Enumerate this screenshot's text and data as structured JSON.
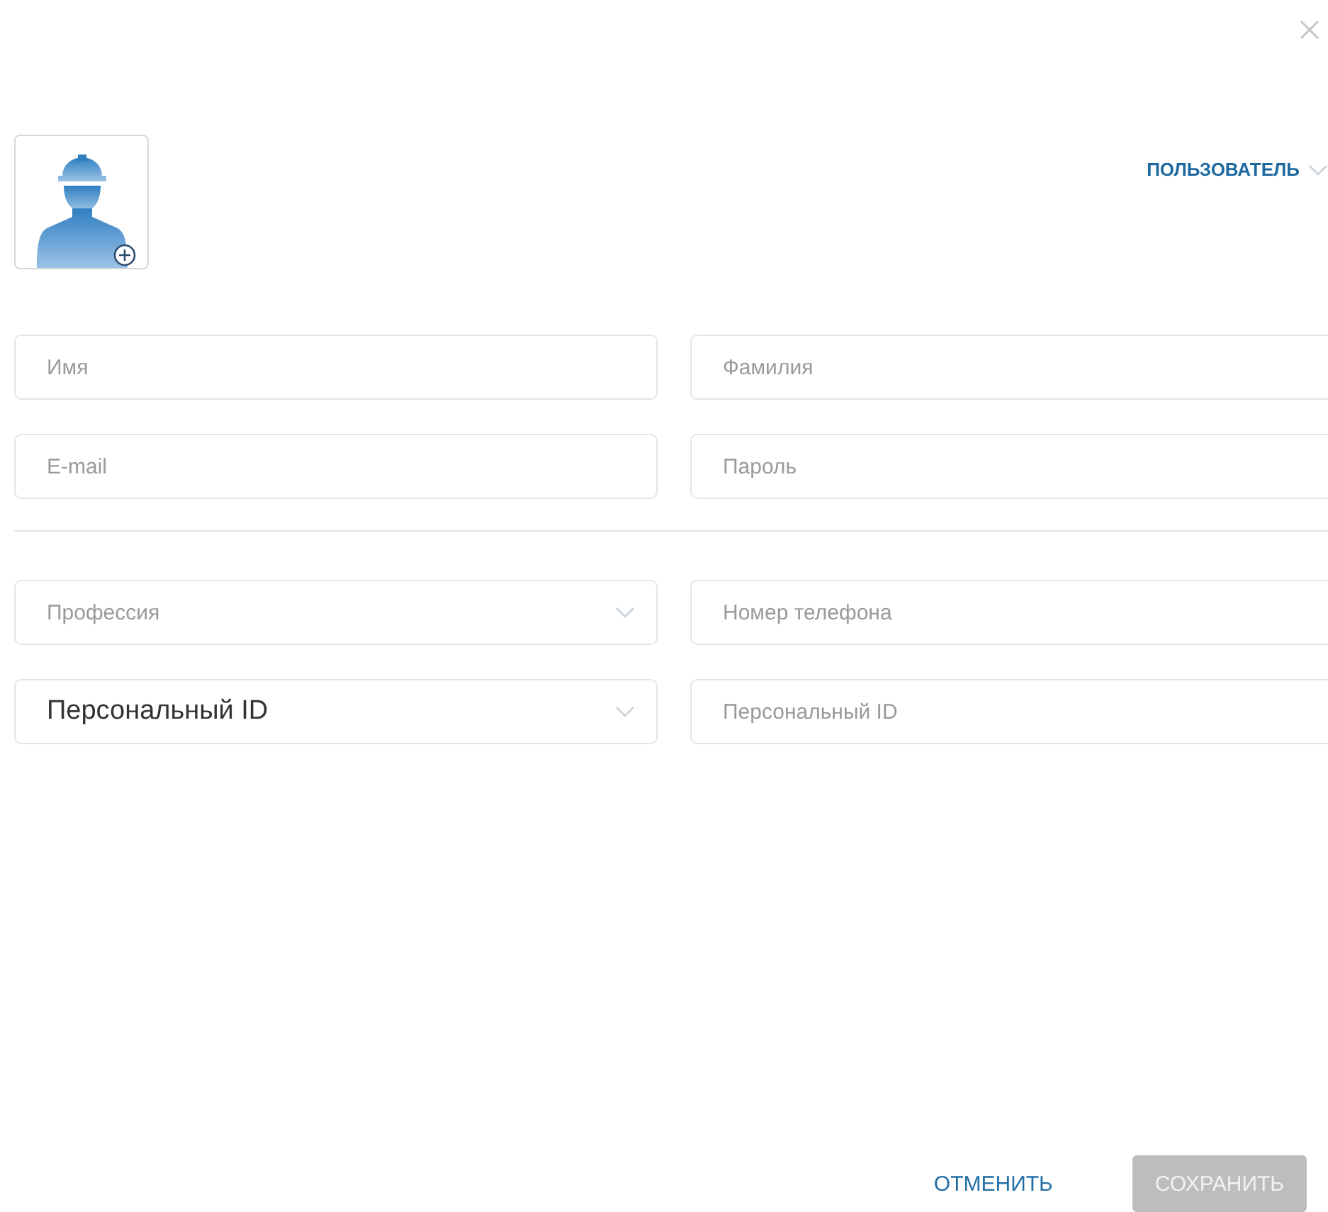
{
  "role_select": {
    "value": "ПОЛЬЗОВАТЕЛЬ"
  },
  "field_groups": [
    {
      "rows": [
        [
          {
            "kind": "input",
            "placeholder": "Имя"
          },
          {
            "kind": "input",
            "placeholder": "Фамилия"
          }
        ],
        [
          {
            "kind": "input",
            "placeholder": "E-mail"
          },
          {
            "kind": "input",
            "placeholder": "Пароль"
          }
        ]
      ]
    },
    {
      "rows": [
        [
          {
            "kind": "select",
            "placeholder": "Профессия"
          },
          {
            "kind": "input",
            "placeholder": "Номер телефона"
          }
        ],
        [
          {
            "kind": "select",
            "value": "Персональный ID"
          },
          {
            "kind": "input",
            "placeholder": "Персональный ID"
          }
        ]
      ]
    }
  ],
  "buttons": [
    {
      "label": "ОТМЕНИТЬ",
      "kind": "text",
      "disabled": false
    },
    {
      "label": "СОХРАНИТЬ",
      "kind": "filled",
      "disabled": true
    }
  ]
}
